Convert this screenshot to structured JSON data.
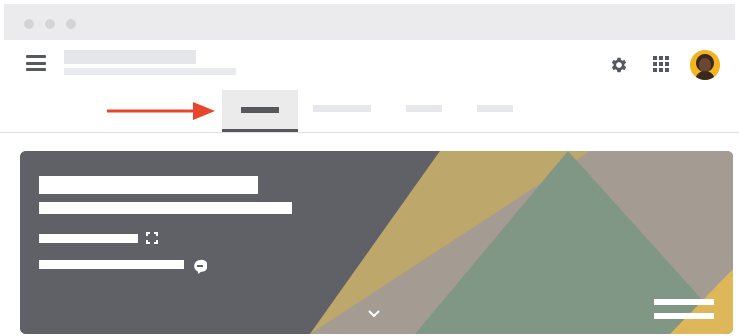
{
  "window": {
    "title": "",
    "dot_color": "#d4d4d8"
  },
  "header": {
    "title": "",
    "subtitle": "",
    "icons": [
      "menu-icon",
      "gear-icon",
      "apps-grid-icon",
      "avatar"
    ]
  },
  "tabs": [
    {
      "label": "",
      "active": true
    },
    {
      "label": "",
      "active": false
    },
    {
      "label": "",
      "active": false
    },
    {
      "label": "",
      "active": false
    }
  ],
  "annotation": {
    "arrow_color": "#e8452c",
    "target": "tab-active"
  },
  "banner": {
    "background_color": "#606166",
    "accent_colors": [
      "#bda76b",
      "#a49c92",
      "#7f9784",
      "#deb75a"
    ],
    "title": "",
    "subtitle": "",
    "meeting_code": "",
    "phone": "",
    "icons": [
      "fullscreen-icon",
      "chat-bubble-icon",
      "chevron-down-icon",
      "menu-lines-icon"
    ]
  },
  "colors": {
    "placeholder": "#e6e7ea",
    "active_tab": "#ebebeb",
    "avatar": "#f2b51e"
  }
}
